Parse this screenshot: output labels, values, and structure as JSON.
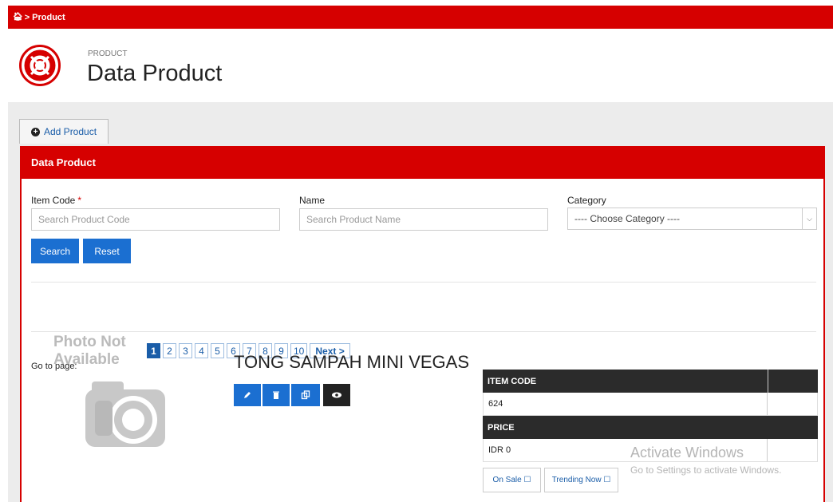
{
  "breadcrumb": {
    "label": "Product"
  },
  "header": {
    "subtitle": "PRODUCT",
    "title": "Data Product"
  },
  "toolbar": {
    "add_label": "Add Product"
  },
  "panel": {
    "title": "Data Product"
  },
  "filters": {
    "item_code_label": "Item Code",
    "item_code_required": "*",
    "item_code_placeholder": "Search Product Code",
    "name_label": "Name",
    "name_placeholder": "Search Product Name",
    "category_label": "Category",
    "category_selected": "---- Choose Category ----",
    "search_label": "Search",
    "reset_label": "Reset"
  },
  "pagination": {
    "label": "Go to page:",
    "pages": [
      "1",
      "2",
      "3",
      "4",
      "5",
      "6",
      "7",
      "8",
      "9",
      "10"
    ],
    "active": "1",
    "next_label": "Next >"
  },
  "product": {
    "photo_text": "Photo Not Available",
    "title": "TONG SAMPAH MINI VEGAS",
    "item_code_header": "ITEM CODE",
    "item_code": "624",
    "price_header": "PRICE",
    "price": "IDR 0",
    "on_sale_label": "On Sale ☐",
    "trending_label": "Trending Now ☐",
    "actions": [
      "edit-icon",
      "trash-icon",
      "copy-icon",
      "eye-icon"
    ]
  },
  "watermark": {
    "line1": "Activate Windows",
    "line2": "Go to Settings to activate Windows."
  },
  "colors": {
    "brand_red": "#d60000",
    "primary_blue": "#1b6fd1",
    "dark": "#2b2b2b"
  }
}
